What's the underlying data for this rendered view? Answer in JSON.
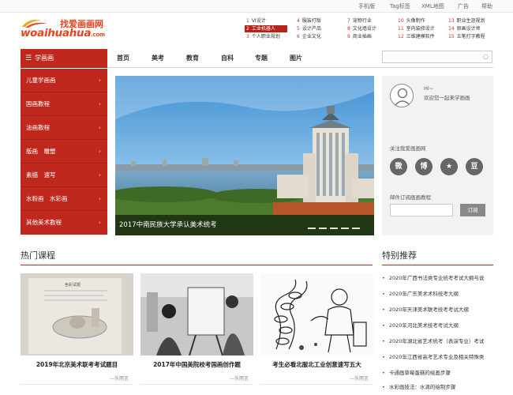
{
  "top_links": [
    "手机版",
    "Tag标签",
    "XML地图",
    "广告",
    "帮助"
  ],
  "logo": {
    "cn": "找爱画画网",
    "en": "woaihuahua",
    "com": ".com"
  },
  "hot_columns": [
    [
      {
        "num": "1",
        "label": "VI设计"
      },
      {
        "num": "2",
        "label": "工业机器人"
      },
      {
        "num": "3",
        "label": "个人职业规划"
      }
    ],
    [
      {
        "num": "4",
        "label": "服装打版"
      },
      {
        "num": "5",
        "label": "设计产品"
      },
      {
        "num": "6",
        "label": "企业文化"
      }
    ],
    [
      {
        "num": "7",
        "label": "宠物行业"
      },
      {
        "num": "8",
        "label": "文化墙设计"
      },
      {
        "num": "9",
        "label": "商业插画"
      }
    ],
    [
      {
        "num": "10",
        "label": "头像制作"
      },
      {
        "num": "11",
        "label": "室内装修设计"
      },
      {
        "num": "12",
        "label": "三维建模软件"
      }
    ],
    [
      {
        "num": "13",
        "label": "职业生涯规划"
      },
      {
        "num": "14",
        "label": "原画设计师"
      },
      {
        "num": "15",
        "label": "五笔打字教程"
      }
    ]
  ],
  "nav": {
    "category_label": "学画画",
    "links": [
      "首页",
      "美考",
      "教育",
      "自科",
      "专题",
      "图片"
    ]
  },
  "sidebar": [
    {
      "label": "儿童学画画"
    },
    {
      "label": "国画教程"
    },
    {
      "label": "油画教程"
    },
    {
      "label": "版画　雕塑"
    },
    {
      "label": "素描　速写"
    },
    {
      "label": "水粉画　水彩画"
    },
    {
      "label": "其他美术教程"
    }
  ],
  "banner": {
    "caption": "2017中南民族大学承认美术统考"
  },
  "user": {
    "greeting": "Hi~",
    "welcome": "欢迎您一起来学画画",
    "follow_label": "关注我爱画画网",
    "social_icons": [
      "wechat-icon",
      "weibo-icon",
      "star-icon",
      "douban-icon"
    ],
    "social_glyphs": [
      "微",
      "博",
      "★",
      "豆"
    ],
    "subscribe_label": "邮件订阅画画教程",
    "subscribe_button": "订阅"
  },
  "hot_courses": {
    "title": "热门课程",
    "items": [
      {
        "title": "2019年北京美术联考考试题目",
        "author": "—乐雨言",
        "thumb_text": "色彩试题"
      },
      {
        "title": "2017年中国美院校考国画创作题",
        "author": "—乐雨言"
      },
      {
        "title": "考生必看北服北工业创意速写五大",
        "author": "—乐雨言"
      }
    ]
  },
  "recommend": {
    "title": "特别推荐",
    "items": [
      "2020年广西书法类专业统考考试大纲与说",
      "2020年广东美术术科统考大纲",
      "2020年天津美术联考统考考试大纲",
      "2020年河北美术统考考试大纲",
      "2020年湖北省艺术统考（表演专业）考试",
      "2020年江西省高考艺术专业及相关特殊类",
      "卡通画草莓蛋糕的绘画步骤",
      "水彩画技法：水滴的绘制步骤"
    ]
  },
  "colors": {
    "accent": "#c0281d",
    "logo": "#e8411b"
  }
}
